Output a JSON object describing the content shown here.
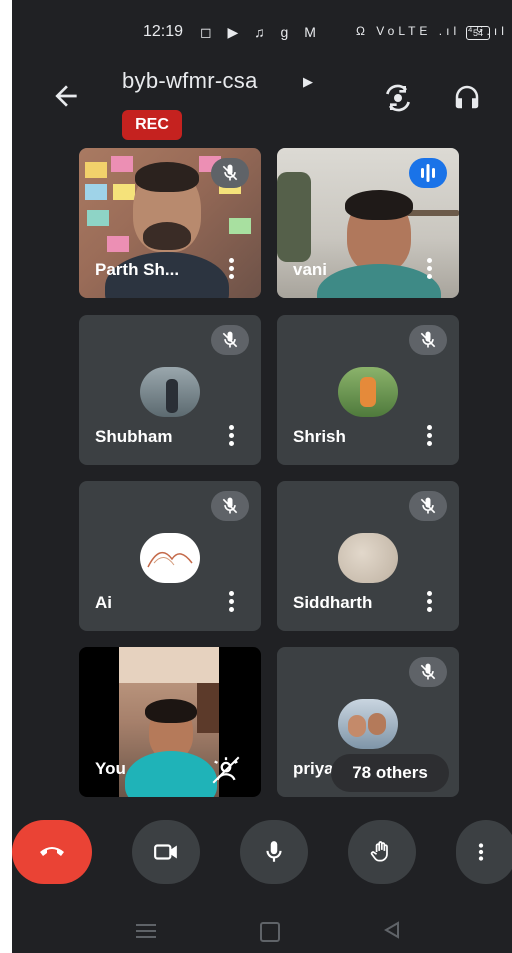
{
  "status_bar": {
    "time": "12:19",
    "left_icons": "◻ ▶ ♫ g M",
    "right_icons": "Ω VoLTE .ıl ⁴ᴳ.ıl",
    "battery": "54"
  },
  "header": {
    "meeting_code": "byb-wfmr-csa",
    "rec_label": "REC"
  },
  "participants": [
    {
      "name": "Parth Sh...",
      "muted": true
    },
    {
      "name": "vani",
      "speaking": true
    },
    {
      "name": "Shubham",
      "muted": true
    },
    {
      "name": "Shrish",
      "muted": true
    },
    {
      "name": "Ai",
      "muted": true
    },
    {
      "name": "Siddharth",
      "muted": true
    },
    {
      "name": "You"
    },
    {
      "name": "priya",
      "muted": true
    }
  ],
  "others_count_label": "78 others",
  "colors": {
    "background": "#202124",
    "tile": "#3c4043",
    "end_call": "#ea4335",
    "rec": "#c5221f",
    "speaking": "#1a73e8"
  },
  "icons": [
    "back-arrow-icon",
    "flip-camera-icon",
    "headphones-icon",
    "mic-off-icon",
    "speaking-icon",
    "more-vert-icon",
    "end-call-icon",
    "camera-icon",
    "mic-icon",
    "raise-hand-icon",
    "effects-icon"
  ]
}
